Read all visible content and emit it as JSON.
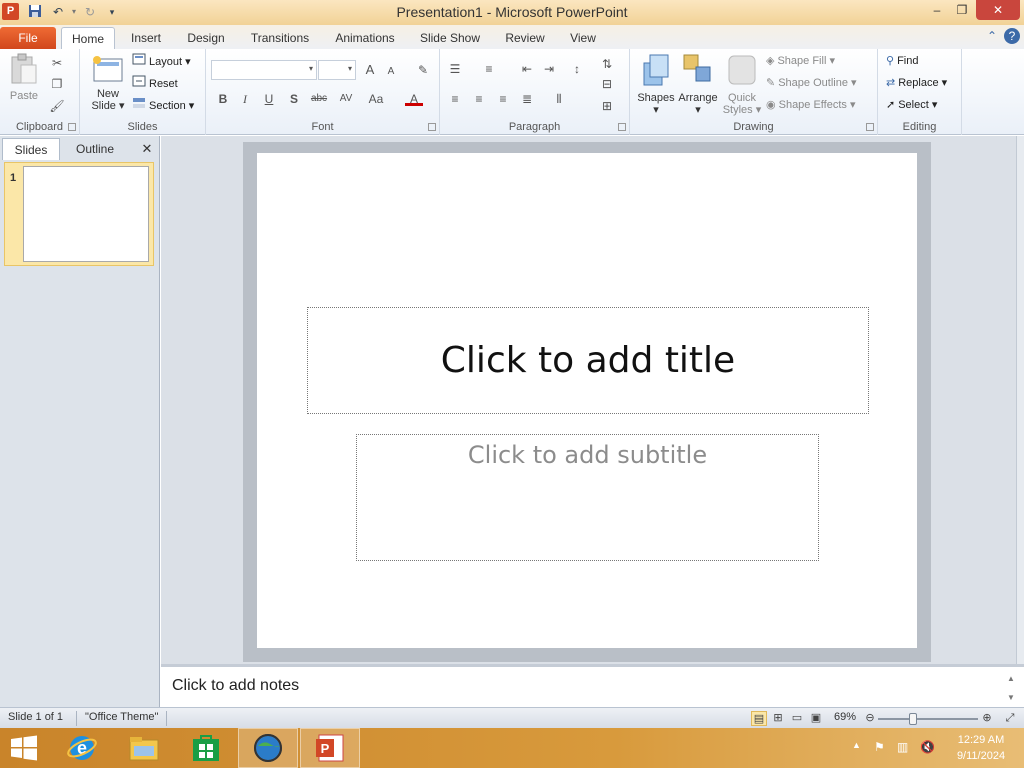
{
  "window": {
    "app_logo": "P",
    "title": "Presentation1  -  Microsoft PowerPoint",
    "minimize": "–",
    "restore": "❐",
    "close": "✕"
  },
  "tabs": {
    "file": "File",
    "home": "Home",
    "insert": "Insert",
    "design": "Design",
    "transitions": "Transitions",
    "animations": "Animations",
    "slide_show": "Slide Show",
    "review": "Review",
    "view": "View"
  },
  "ribbon": {
    "clipboard": {
      "label": "Clipboard",
      "paste": "Paste"
    },
    "slides": {
      "label": "Slides",
      "new_slide": "New Slide",
      "layout": "Layout",
      "reset": "Reset",
      "section": "Section"
    },
    "font": {
      "label": "Font",
      "bold": "B",
      "italic": "I",
      "underline": "U",
      "shadow": "S",
      "strike": "abc",
      "spacing": "AV",
      "change_case": "Aa",
      "font_color": "A",
      "grow": "A",
      "shrink": "A"
    },
    "paragraph": {
      "label": "Paragraph"
    },
    "drawing": {
      "label": "Drawing",
      "shapes": "Shapes",
      "arrange": "Arrange",
      "quick_styles": "Quick Styles",
      "shape_fill": "Shape Fill",
      "shape_outline": "Shape Outline",
      "shape_effects": "Shape Effects"
    },
    "editing": {
      "label": "Editing",
      "find": "Find",
      "replace": "Replace",
      "select": "Select"
    }
  },
  "panel": {
    "tab_slides": "Slides",
    "tab_outline": "Outline",
    "close": "✕",
    "slide_number": "1"
  },
  "slide": {
    "title_placeholder": "Click to add title",
    "subtitle_placeholder": "Click to add subtitle"
  },
  "notes": {
    "placeholder": "Click to add notes"
  },
  "status": {
    "slide_info": "Slide 1 of 1",
    "theme": "\"Office Theme\"",
    "zoom": "69%"
  },
  "taskbar": {
    "time": "12:29 AM",
    "date": "9/11/2024"
  },
  "colors": {
    "file_tab": "#d1471c",
    "powerpoint": "#d24726",
    "taskbar": "#d89a3c",
    "thumb_highlight": "#fbe7a8"
  }
}
